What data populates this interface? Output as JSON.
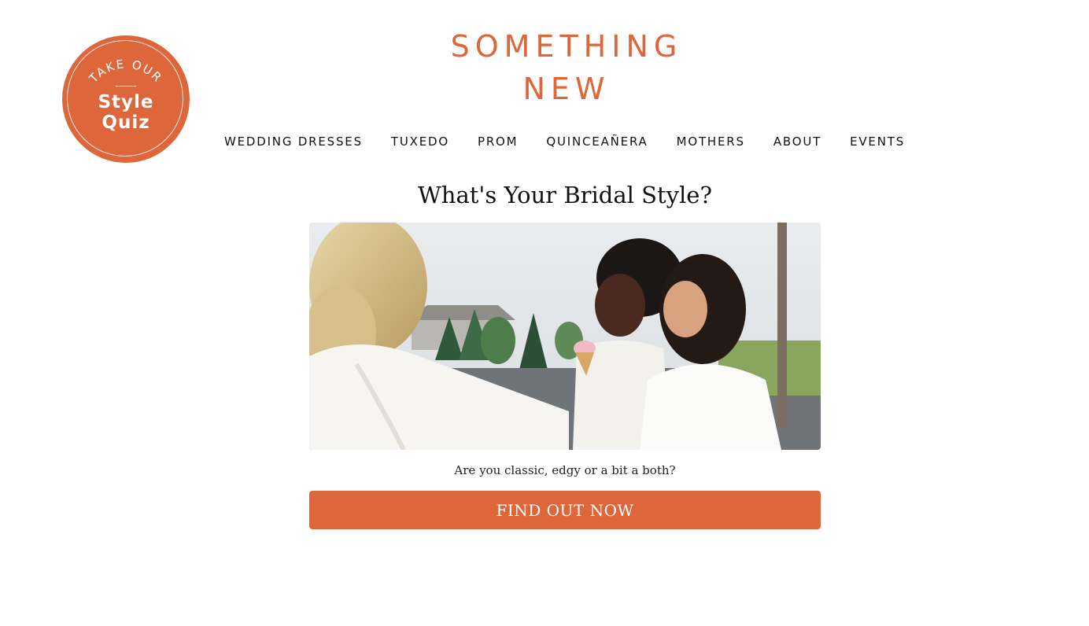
{
  "quiz_badge": {
    "top_text": "TAKE OUR",
    "title_line1": "Style",
    "title_line2": "Quiz"
  },
  "logo": {
    "line1": "SOMETHING",
    "line2": "NEW"
  },
  "nav": {
    "items": [
      {
        "label": "WEDDING DRESSES"
      },
      {
        "label": "TUXEDO"
      },
      {
        "label": "PROM"
      },
      {
        "label": "QUINCEAÑERA"
      },
      {
        "label": "MOTHERS"
      },
      {
        "label": "ABOUT"
      },
      {
        "label": "EVENTS"
      }
    ]
  },
  "main": {
    "heading": "What's Your Bridal Style?",
    "subtitle": "Are you classic, edgy or a bit a both?",
    "cta_label": "FIND OUT NOW"
  },
  "colors": {
    "brand": "#dd663a",
    "text": "#111111",
    "background": "#ffffff"
  }
}
